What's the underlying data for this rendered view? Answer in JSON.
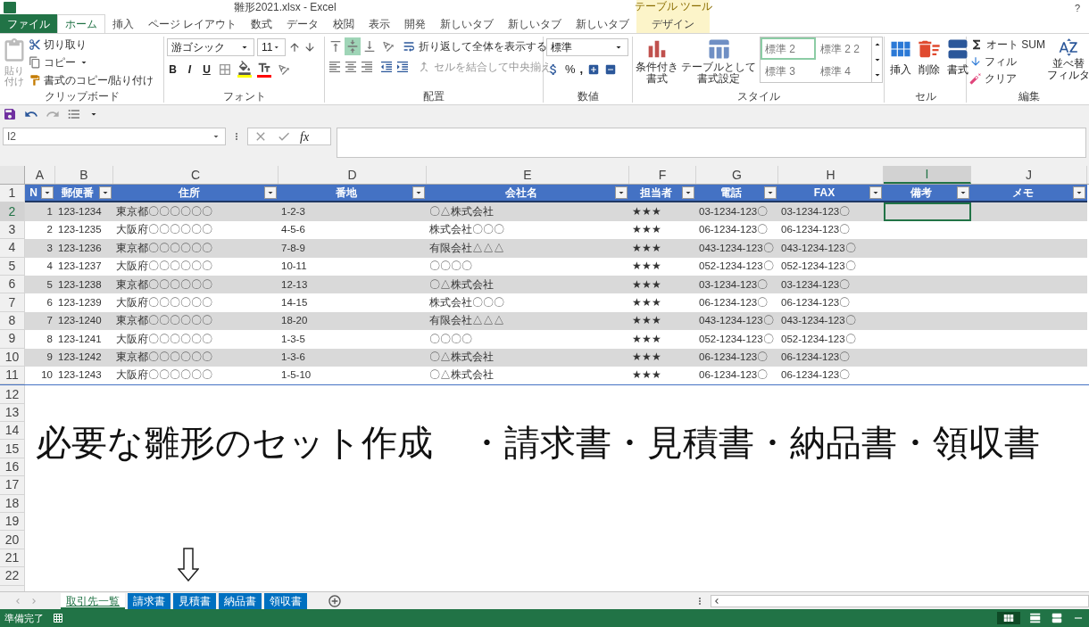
{
  "window": {
    "title": "雛形2021.xlsx - Excel",
    "help": "?"
  },
  "ribbon_tabs": [
    {
      "label": "ファイル",
      "kind": "file",
      "selected": false
    },
    {
      "label": "ホーム",
      "kind": "tab",
      "selected": true
    },
    {
      "label": "挿入",
      "kind": "tab",
      "selected": false
    },
    {
      "label": "ページ レイアウト",
      "kind": "tab",
      "selected": false
    },
    {
      "label": "数式",
      "kind": "tab",
      "selected": false
    },
    {
      "label": "データ",
      "kind": "tab",
      "selected": false
    },
    {
      "label": "校閲",
      "kind": "tab",
      "selected": false
    },
    {
      "label": "表示",
      "kind": "tab",
      "selected": false
    },
    {
      "label": "開発",
      "kind": "tab",
      "selected": false
    },
    {
      "label": "新しいタブ",
      "kind": "tab",
      "selected": false
    },
    {
      "label": "新しいタブ",
      "kind": "tab",
      "selected": false
    },
    {
      "label": "新しいタブ",
      "kind": "tab",
      "selected": false
    },
    {
      "label": "デザイン",
      "kind": "contextual",
      "group": "テーブル ツール",
      "selected": false
    }
  ],
  "ribbon": {
    "clipboard": {
      "paste": "貼り付け",
      "cut": "切り取り",
      "copy": "コピー",
      "format_painter": "書式のコピー/貼り付け",
      "label": "クリップボード"
    },
    "font": {
      "name": "游ゴシック",
      "size": "11",
      "bold": "B",
      "italic": "I",
      "underline": "U",
      "label": "フォント"
    },
    "alignment": {
      "vertical": [
        {
          "selected": false
        },
        {
          "selected": true
        },
        {
          "selected": false
        }
      ],
      "wrap": "折り返して全体を表示する",
      "merge": "セルを結合して中央揃え",
      "label": "配置"
    },
    "number": {
      "format": "標準",
      "percent": "%",
      "comma": ",",
      "label": "数値"
    },
    "styles": {
      "conditional": "条件付き書式",
      "as_table": "テーブルとして書式設定",
      "gallery": [
        {
          "label": "標準 2",
          "selected": true
        },
        {
          "label": "標準 2 2",
          "selected": false
        },
        {
          "label": "標準 3",
          "selected": false
        },
        {
          "label": "標準 4",
          "selected": false
        }
      ],
      "label": "スタイル"
    },
    "cells": {
      "insert": "挿入",
      "delete": "削除",
      "format": "書式",
      "label": "セル"
    },
    "editing": {
      "autosum": "オート SUM",
      "fill": "フィル",
      "clear": "クリア",
      "sort": "並べ替",
      "filter": "フィルタ",
      "label": "編集"
    }
  },
  "formula_bar": {
    "name_box": "I2",
    "fx": "fx"
  },
  "header_row_number": "1",
  "columns": [
    {
      "letter": "A",
      "header": "N",
      "selected": false
    },
    {
      "letter": "B",
      "header": "郵便番",
      "selected": false
    },
    {
      "letter": "C",
      "header": "住所",
      "selected": false
    },
    {
      "letter": "D",
      "header": "番地",
      "selected": false
    },
    {
      "letter": "E",
      "header": "会社名",
      "selected": false
    },
    {
      "letter": "F",
      "header": "担当者",
      "selected": false
    },
    {
      "letter": "G",
      "header": "電話",
      "selected": false
    },
    {
      "letter": "H",
      "header": "FAX",
      "selected": false
    },
    {
      "letter": "I",
      "header": "備考",
      "selected": true
    },
    {
      "letter": "J",
      "header": "メモ",
      "selected": false
    }
  ],
  "rows": [
    {
      "number": "2",
      "selected": true,
      "cells": [
        "1",
        "123-1234",
        "東京都〇〇〇〇〇〇",
        "1-2-3",
        "〇△株式会社",
        "★★★",
        "03-1234-123〇",
        "03-1234-123〇",
        "",
        ""
      ]
    },
    {
      "number": "3",
      "selected": false,
      "cells": [
        "2",
        "123-1235",
        "大阪府〇〇〇〇〇〇",
        "4-5-6",
        "株式会社〇〇〇",
        "★★★",
        "06-1234-123〇",
        "06-1234-123〇",
        "",
        ""
      ]
    },
    {
      "number": "4",
      "selected": false,
      "cells": [
        "3",
        "123-1236",
        "東京都〇〇〇〇〇〇",
        "7-8-9",
        "有限会社△△△",
        "★★★",
        "043-1234-123〇",
        "043-1234-123〇",
        "",
        ""
      ]
    },
    {
      "number": "5",
      "selected": false,
      "cells": [
        "4",
        "123-1237",
        "大阪府〇〇〇〇〇〇",
        "10-11",
        "〇〇〇〇",
        "★★★",
        "052-1234-123〇",
        "052-1234-123〇",
        "",
        ""
      ]
    },
    {
      "number": "6",
      "selected": false,
      "cells": [
        "5",
        "123-1238",
        "東京都〇〇〇〇〇〇",
        "12-13",
        "〇△株式会社",
        "★★★",
        "03-1234-123〇",
        "03-1234-123〇",
        "",
        ""
      ]
    },
    {
      "number": "7",
      "selected": false,
      "cells": [
        "6",
        "123-1239",
        "大阪府〇〇〇〇〇〇",
        "14-15",
        "株式会社〇〇〇",
        "★★★",
        "06-1234-123〇",
        "06-1234-123〇",
        "",
        ""
      ]
    },
    {
      "number": "8",
      "selected": false,
      "cells": [
        "7",
        "123-1240",
        "東京都〇〇〇〇〇〇",
        "18-20",
        "有限会社△△△",
        "★★★",
        "043-1234-123〇",
        "043-1234-123〇",
        "",
        ""
      ]
    },
    {
      "number": "9",
      "selected": false,
      "cells": [
        "8",
        "123-1241",
        "大阪府〇〇〇〇〇〇",
        "1-3-5",
        "〇〇〇〇",
        "★★★",
        "052-1234-123〇",
        "052-1234-123〇",
        "",
        ""
      ]
    },
    {
      "number": "10",
      "selected": false,
      "cells": [
        "9",
        "123-1242",
        "東京都〇〇〇〇〇〇",
        "1-3-6",
        "〇△株式会社",
        "★★★",
        "06-1234-123〇",
        "06-1234-123〇",
        "",
        ""
      ]
    },
    {
      "number": "11",
      "selected": false,
      "cells": [
        "10",
        "123-1243",
        "大阪府〇〇〇〇〇〇",
        "1-5-10",
        "〇△株式会社",
        "★★★",
        "06-1234-123〇",
        "06-1234-123〇",
        "",
        ""
      ]
    }
  ],
  "empty_rows": [
    "12",
    "13",
    "14",
    "15",
    "16",
    "17",
    "18",
    "19",
    "20",
    "21",
    "22"
  ],
  "note": "必要な雛形のセット作成　・請求書・見積書・納品書・領収書",
  "sheet_tabs": [
    {
      "label": "取引先一覧",
      "selected": true
    },
    {
      "label": "請求書",
      "selected": false
    },
    {
      "label": "見積書",
      "selected": false
    },
    {
      "label": "納品書",
      "selected": false
    },
    {
      "label": "領収書",
      "selected": false
    }
  ],
  "status_bar": {
    "text": "準備完了"
  }
}
